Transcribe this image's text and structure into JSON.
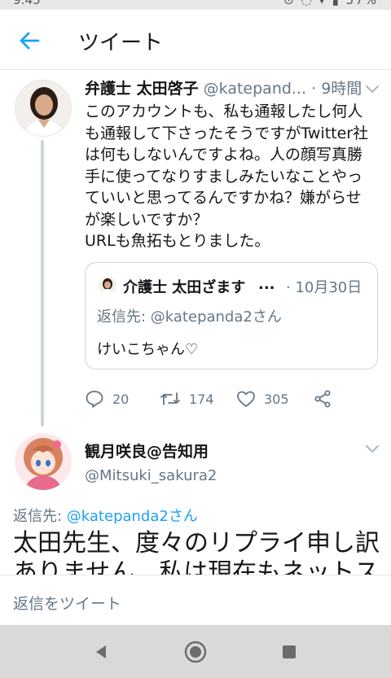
{
  "header": {
    "title": "ツイート"
  },
  "tweet": {
    "author_name": "弁護士 太田啓子",
    "author_handle": "@katepand...",
    "separator": "·",
    "time": "9時間",
    "text": "このアカウントも、私も通報したし何人\nも通報して下さったそうですがTwitter社\nは何もしないんですよね。人の顔写真勝\n手に使ってなりすましみたいなことやっ\nていいと思ってるんですかね？嫌がらせ\nが楽しいですか？\nURLも魚拓もとりました。",
    "quote": {
      "name": "介護士 太田ざます",
      "ellipsis": "...",
      "time": "· 10月30日",
      "reply_prefix": "返信先: ",
      "reply_handle": "@katepanda2さん",
      "text": "けいこちゃん♡"
    },
    "actions": {
      "replies": "20",
      "retweets": "174",
      "likes": "305"
    }
  },
  "reply_tweet": {
    "author_name": "観月咲良@告知用",
    "author_handle": "@Mitsuki_sakura2",
    "reply_prefix": "返信先: ",
    "reply_handle": "@katepanda2さん",
    "text_line1": "太田先生、度々のリプライ申し訳",
    "text_line2": "ありません、私は現在もネットス"
  },
  "compose": {
    "placeholder": "返信をツイート"
  },
  "colors": {
    "accent": "#1da1f2",
    "muted": "#657786",
    "border": "#ccd6dd"
  },
  "icons": [
    "back-arrow-icon",
    "caret-down-icon",
    "reply-icon",
    "retweet-icon",
    "like-icon",
    "share-icon",
    "nav-back-icon",
    "nav-home-icon",
    "nav-recents-icon"
  ]
}
